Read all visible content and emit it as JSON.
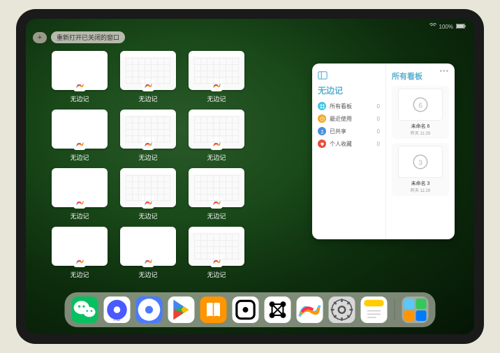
{
  "status": {
    "time": "",
    "indicators": "100%"
  },
  "topbar": {
    "plus": "+",
    "reopen": "重新打开已关闭的窗口"
  },
  "app": {
    "name": "无边记"
  },
  "grid": [
    {
      "label": "无边记",
      "variant": "blank"
    },
    {
      "label": "无边记",
      "variant": "calendar"
    },
    {
      "label": "无边记",
      "variant": "calendar"
    },
    {
      "label": null,
      "variant": null
    },
    {
      "label": "无边记",
      "variant": "blank"
    },
    {
      "label": "无边记",
      "variant": "calendar"
    },
    {
      "label": "无边记",
      "variant": "calendar"
    },
    {
      "label": null,
      "variant": null
    },
    {
      "label": "无边记",
      "variant": "blank"
    },
    {
      "label": "无边记",
      "variant": "calendar"
    },
    {
      "label": "无边记",
      "variant": "calendar"
    },
    {
      "label": null,
      "variant": null
    },
    {
      "label": "无边记",
      "variant": "blank"
    },
    {
      "label": "无边记",
      "variant": "blank"
    },
    {
      "label": "无边记",
      "variant": "calendar"
    }
  ],
  "panel": {
    "app_title": "无边记",
    "right_title": "所有看板",
    "categories": [
      {
        "icon": "grid",
        "label": "所有看板",
        "count": "0",
        "color": "#42c4e6"
      },
      {
        "icon": "clock",
        "label": "最近使用",
        "count": "0",
        "color": "#f5a623"
      },
      {
        "icon": "people",
        "label": "已共享",
        "count": "0",
        "color": "#4a90e2"
      },
      {
        "icon": "heart",
        "label": "个人收藏",
        "count": "0",
        "color": "#e74c3c"
      }
    ],
    "boards": [
      {
        "label": "未命名 6",
        "date": "昨天 11:29",
        "glyph": "6"
      },
      {
        "label": "未命名 3",
        "date": "昨天 11:29",
        "glyph": "3"
      }
    ]
  },
  "dock": [
    {
      "name": "wechat",
      "bg": "#07c160"
    },
    {
      "name": "quark-hd",
      "bg": "#ffffff"
    },
    {
      "name": "quark",
      "bg": "#4a7aff"
    },
    {
      "name": "play",
      "bg": "#ffffff"
    },
    {
      "name": "books",
      "bg": "#ff9500"
    },
    {
      "name": "dice",
      "bg": "#ffffff"
    },
    {
      "name": "graph",
      "bg": "#ffffff"
    },
    {
      "name": "freeform",
      "bg": "#ffffff"
    },
    {
      "name": "settings",
      "bg": "#d8d8d8"
    },
    {
      "name": "notes",
      "bg": "#ffffff"
    }
  ]
}
